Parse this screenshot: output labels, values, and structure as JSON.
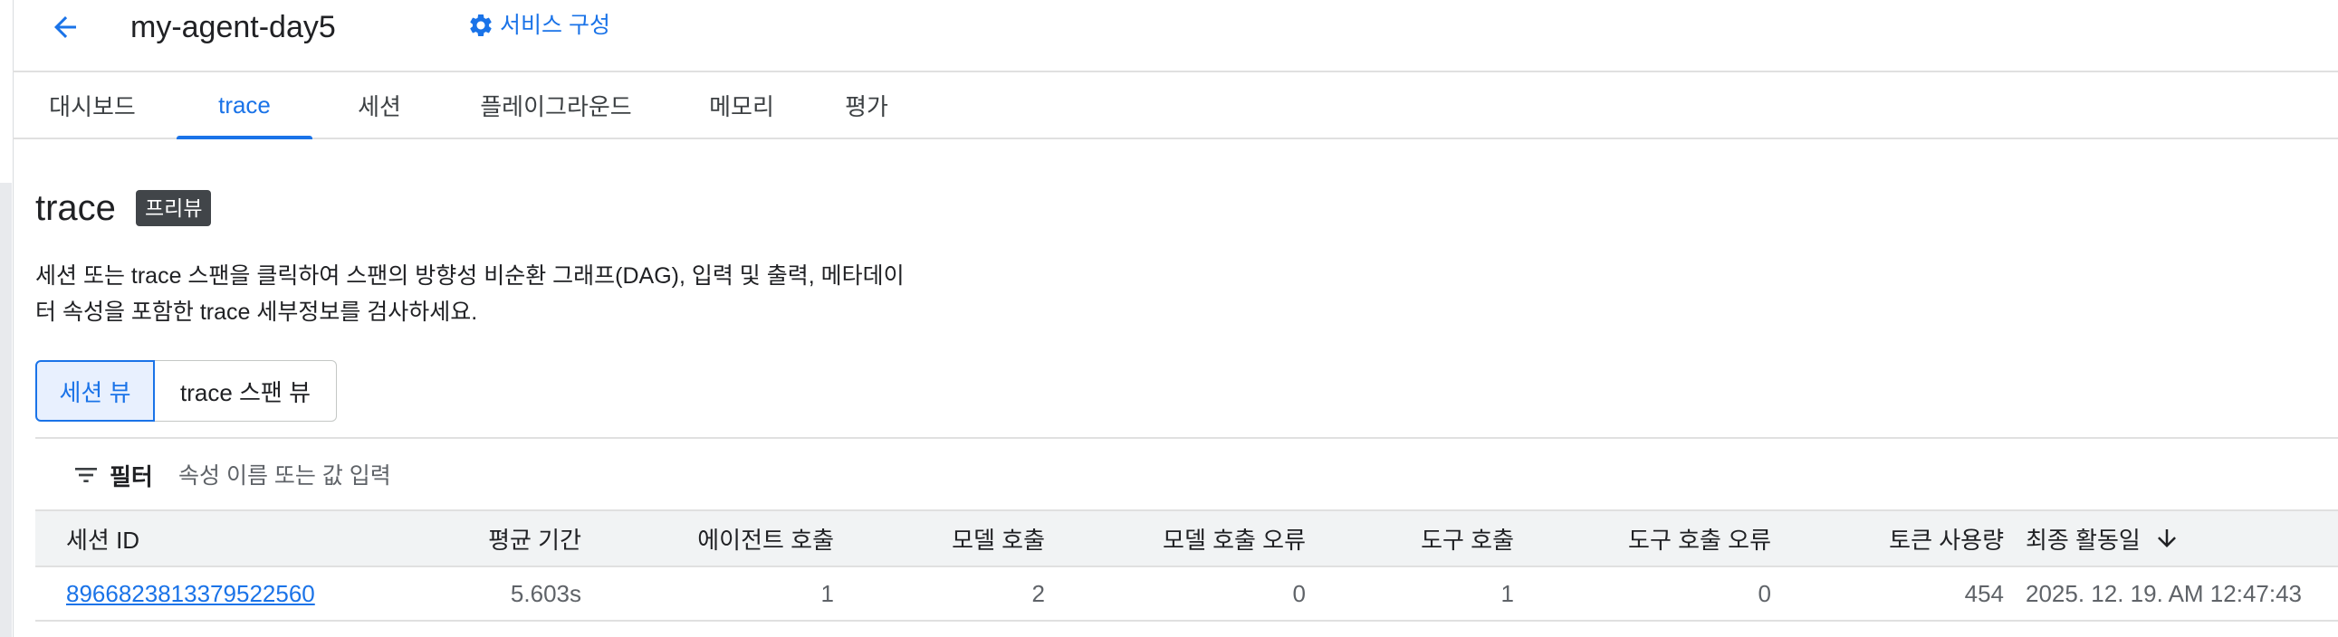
{
  "header": {
    "title": "my-agent-day5",
    "service_config_label": "서비스 구성",
    "back_icon": "arrow-back-icon",
    "gear_icon": "gear-icon"
  },
  "tabs": [
    {
      "label": "대시보드",
      "active": false
    },
    {
      "label": "trace",
      "active": true
    },
    {
      "label": "세션",
      "active": false
    },
    {
      "label": "플레이그라운드",
      "active": false
    },
    {
      "label": "메모리",
      "active": false
    },
    {
      "label": "평가",
      "active": false
    }
  ],
  "section": {
    "title": "trace",
    "badge": "프리뷰",
    "description_line1": "세션 또는 trace 스팬을 클릭하여 스팬의 방향성 비순환 그래프(DAG), 입력 및 출력, 메타데이",
    "description_line2": "터 속성을 포함한 trace 세부정보를 검사하세요."
  },
  "view_toggle": {
    "session_view": "세션 뷰",
    "span_view": "trace 스팬 뷰",
    "selected": "세션 뷰"
  },
  "filter": {
    "label": "필터",
    "placeholder": "속성 이름 또는 값 입력",
    "icon": "filter-list-icon"
  },
  "table": {
    "columns": {
      "session_id": "세션 ID",
      "avg_duration": "평균 기간",
      "agent_calls": "에이전트 호출",
      "model_calls": "모델 호출",
      "model_errors": "모델 호출 오류",
      "tool_calls": "도구 호출",
      "tool_errors": "도구 호출 오류",
      "token_usage": "토큰 사용량",
      "last_active": "최종 활동일"
    },
    "sort_icon": "arrow-downward-icon",
    "rows": [
      {
        "session_id": "8966823813379522560",
        "avg_duration": "5.603s",
        "agent_calls": "1",
        "model_calls": "2",
        "model_errors": "0",
        "tool_calls": "1",
        "tool_errors": "0",
        "token_usage": "454",
        "last_active": "2025. 12. 19. AM 12:47:43"
      }
    ]
  },
  "colors": {
    "accent": "#1a73e8",
    "text": "#202124",
    "muted": "#5f6368",
    "badge_bg": "#414549",
    "header_row_bg": "#f1f3f4"
  }
}
